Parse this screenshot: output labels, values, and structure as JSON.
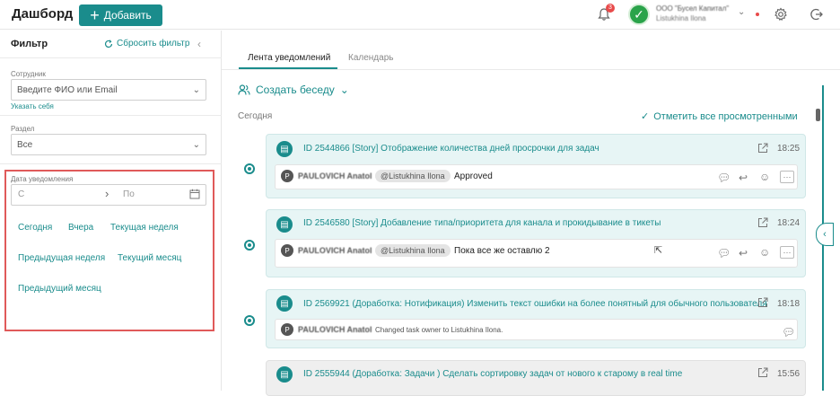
{
  "header": {
    "title": "Дашборд",
    "add_label": "Добавить",
    "notification_count": "3",
    "company_name": "ООО \"Бусел Капитал\"",
    "company_user": "Listukhina Ilona"
  },
  "filter": {
    "title": "Фильтр",
    "reset_label": "Сбросить фильтр",
    "employee_label": "Сотрудник",
    "employee_placeholder": "Введите ФИО или Email",
    "self_link": "Указать себя",
    "section_label": "Раздел",
    "section_value": "Все",
    "date_label": "Дата уведомления",
    "date_from_placeholder": "С",
    "date_to_placeholder": "По",
    "quick_ranges": [
      "Сегодня",
      "Вчера",
      "Текущая неделя",
      "Предыдущая неделя",
      "Текущий месяц",
      "Предыдущий месяц"
    ]
  },
  "tabs": [
    {
      "label": "Лента уведомлений",
      "active": true
    },
    {
      "label": "Календарь",
      "active": false
    }
  ],
  "feed": {
    "create_chat_label": "Создать беседу",
    "day_label": "Сегодня",
    "mark_all_label": "Отметить все просмотренными",
    "cards": [
      {
        "title": "ID 2544866 [Story] Отображение количества дней просрочки для задач",
        "time": "18:25",
        "author": "PAULOVICH Anatol",
        "mention": "@Listukhina Ilona",
        "text": "Approved"
      },
      {
        "title": "ID 2546580 [Story] Добавление типа/приоритета для канала и прокидывание в тикеты",
        "time": "18:24",
        "author": "PAULOVICH Anatol",
        "mention": "@Listukhina Ilona",
        "text": "Пока все же оставлю 2"
      },
      {
        "title": "ID 2569921 (Доработка: Нотификация) Изменить текст ошибки на более понятный для обычного пользователя",
        "time": "18:18",
        "author": "PAULOVICH Anatol",
        "text": "Changed task owner to Listukhina Ilona."
      },
      {
        "title": "ID 2555944 (Доработка: Задачи ) Сделать сортировку задач от нового к старому в real time",
        "time": "15:56"
      }
    ]
  },
  "colors": {
    "accent": "#1a8c8c",
    "highlight_border": "#e05a5a",
    "badge": "#e84a4a"
  }
}
